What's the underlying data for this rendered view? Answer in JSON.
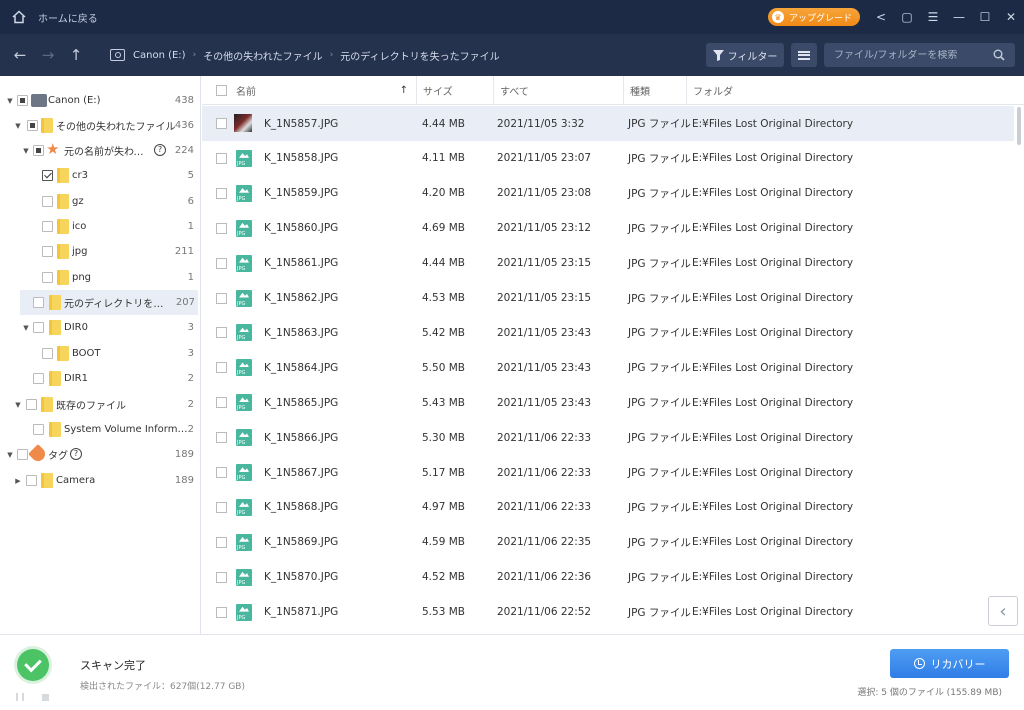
{
  "titlebar": {
    "home_label": "ホームに戻る",
    "upgrade_label": "アップグレード",
    "icons": [
      "share-icon",
      "feedback-icon",
      "menu-icon",
      "minimize-icon",
      "maximize-icon",
      "close-icon"
    ]
  },
  "navbar": {
    "breadcrumbs": [
      "Canon (E:)",
      "その他の失われたファイル",
      "元のディレクトリを失ったファイル"
    ],
    "filter_label": "フィルター",
    "search_placeholder": "ファイル/フォルダーを検索"
  },
  "sidebar": {
    "items": [
      {
        "label": "Canon (E:)",
        "count": "438"
      },
      {
        "label": "その他の失われたファイル",
        "count": "436"
      },
      {
        "label": "元の名前が失われ…",
        "count": "224"
      },
      {
        "label": "cr3",
        "count": "5"
      },
      {
        "label": "gz",
        "count": "6"
      },
      {
        "label": "ico",
        "count": "1"
      },
      {
        "label": "jpg",
        "count": "211"
      },
      {
        "label": "png",
        "count": "1"
      },
      {
        "label": "元のディレクトリを失った…",
        "count": "207"
      },
      {
        "label": "DIR0",
        "count": "3"
      },
      {
        "label": "BOOT",
        "count": "3"
      },
      {
        "label": "DIR1",
        "count": "2"
      },
      {
        "label": "既存のファイル",
        "count": "2"
      },
      {
        "label": "System Volume Inform…",
        "count": "2"
      },
      {
        "label": "タグ",
        "count": "189"
      },
      {
        "label": "Camera",
        "count": "189"
      }
    ]
  },
  "table": {
    "headers": {
      "name": "名前",
      "size": "サイズ",
      "date": "すべて",
      "type": "種類",
      "folder": "フォルダ"
    },
    "rows": [
      {
        "name": "K_1N5857.JPG",
        "size": "4.44 MB",
        "date": "2021/11/05 3:32",
        "type": "JPG ファイル",
        "folder": "E:¥Files Lost Original Directory"
      },
      {
        "name": "K_1N5858.JPG",
        "size": "4.11 MB",
        "date": "2021/11/05 23:07",
        "type": "JPG ファイル",
        "folder": "E:¥Files Lost Original Directory"
      },
      {
        "name": "K_1N5859.JPG",
        "size": "4.20 MB",
        "date": "2021/11/05 23:08",
        "type": "JPG ファイル",
        "folder": "E:¥Files Lost Original Directory"
      },
      {
        "name": "K_1N5860.JPG",
        "size": "4.69 MB",
        "date": "2021/11/05 23:12",
        "type": "JPG ファイル",
        "folder": "E:¥Files Lost Original Directory"
      },
      {
        "name": "K_1N5861.JPG",
        "size": "4.44 MB",
        "date": "2021/11/05 23:15",
        "type": "JPG ファイル",
        "folder": "E:¥Files Lost Original Directory"
      },
      {
        "name": "K_1N5862.JPG",
        "size": "4.53 MB",
        "date": "2021/11/05 23:15",
        "type": "JPG ファイル",
        "folder": "E:¥Files Lost Original Directory"
      },
      {
        "name": "K_1N5863.JPG",
        "size": "5.42 MB",
        "date": "2021/11/05 23:43",
        "type": "JPG ファイル",
        "folder": "E:¥Files Lost Original Directory"
      },
      {
        "name": "K_1N5864.JPG",
        "size": "5.50 MB",
        "date": "2021/11/05 23:43",
        "type": "JPG ファイル",
        "folder": "E:¥Files Lost Original Directory"
      },
      {
        "name": "K_1N5865.JPG",
        "size": "5.43 MB",
        "date": "2021/11/05 23:43",
        "type": "JPG ファイル",
        "folder": "E:¥Files Lost Original Directory"
      },
      {
        "name": "K_1N5866.JPG",
        "size": "5.30 MB",
        "date": "2021/11/06 22:33",
        "type": "JPG ファイル",
        "folder": "E:¥Files Lost Original Directory"
      },
      {
        "name": "K_1N5867.JPG",
        "size": "5.17 MB",
        "date": "2021/11/06 22:33",
        "type": "JPG ファイル",
        "folder": "E:¥Files Lost Original Directory"
      },
      {
        "name": "K_1N5868.JPG",
        "size": "4.97 MB",
        "date": "2021/11/06 22:33",
        "type": "JPG ファイル",
        "folder": "E:¥Files Lost Original Directory"
      },
      {
        "name": "K_1N5869.JPG",
        "size": "4.59 MB",
        "date": "2021/11/06 22:35",
        "type": "JPG ファイル",
        "folder": "E:¥Files Lost Original Directory"
      },
      {
        "name": "K_1N5870.JPG",
        "size": "4.52 MB",
        "date": "2021/11/06 22:36",
        "type": "JPG ファイル",
        "folder": "E:¥Files Lost Original Directory"
      },
      {
        "name": "K_1N5871.JPG",
        "size": "5.53 MB",
        "date": "2021/11/06 22:52",
        "type": "JPG ファイル",
        "folder": "E:¥Files Lost Original Directory"
      }
    ]
  },
  "status": {
    "title": "スキャン完了",
    "subtitle": "検出されたファイル：627個(12.77 GB)",
    "recover_label": "リカバリー",
    "selection": "選択: 5 個のファイル (155.89 MB)"
  },
  "colors": {
    "titlebar": "#1c2a45",
    "navbar": "#24324e",
    "accent": "#2f7de6",
    "upgrade": "#f08a17",
    "done": "#4cc466"
  }
}
